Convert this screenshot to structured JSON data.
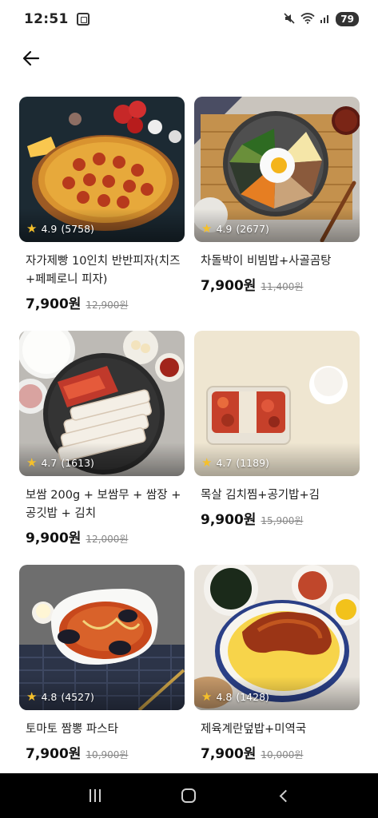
{
  "status_bar": {
    "time": "12:51",
    "battery": "79"
  },
  "products": [
    {
      "title": "자가제빵 10인치 반반피자(치즈+페페로니 피자)",
      "rating": "4.9",
      "reviews": "(5758)",
      "price": "7,900원",
      "original_price": "12,900원"
    },
    {
      "title": "차돌박이 비빔밥+사골곰탕",
      "rating": "4.9",
      "reviews": "(2677)",
      "price": "7,900원",
      "original_price": "11,400원"
    },
    {
      "title": "보쌈 200g + 보쌈무 + 쌈장 + 공깃밥 + 김치",
      "rating": "4.7",
      "reviews": "(1613)",
      "price": "9,900원",
      "original_price": "12,000원"
    },
    {
      "title": "목살 김치찜+공기밥+김",
      "rating": "4.7",
      "reviews": "(1189)",
      "price": "9,900원",
      "original_price": "15,900원"
    },
    {
      "title": "토마토 짬뽕 파스타",
      "rating": "4.8",
      "reviews": "(4527)",
      "price": "7,900원",
      "original_price": "10,900원"
    },
    {
      "title": "제육계란덮밥+미역국",
      "rating": "4.8",
      "reviews": "(1428)",
      "price": "7,900원",
      "original_price": "10,000원"
    }
  ]
}
